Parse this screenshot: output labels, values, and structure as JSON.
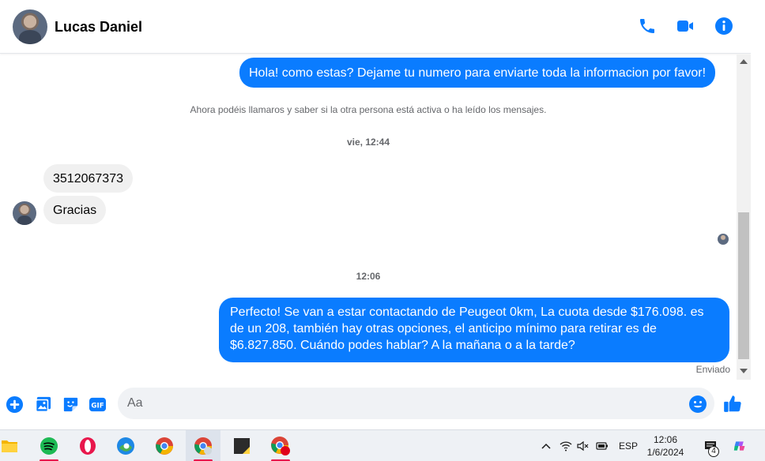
{
  "header": {
    "contact_name": "Lucas Daniel",
    "icons": [
      "phone-icon",
      "video-icon",
      "info-icon"
    ]
  },
  "messages": {
    "out_1": "Hola! como estas? Dejame tu numero para enviarte toda la informacion por favor!",
    "system_note": "Ahora podéis llamaros y saber si la otra persona está activa o ha leído los mensajes.",
    "time_1": "vie, 12:44",
    "in_1": "3512067373",
    "in_2": "Gracias",
    "time_2": "12:06",
    "out_2": "Perfecto!  Se van a estar contactando de Peugeot 0km, La cuota desde $176.098. es de un 208, también hay otras opciones, el anticipo mínimo para retirar es de $6.827.850. Cuándo podes hablar? A la mañana o a la tarde?",
    "status": "Enviado"
  },
  "composer": {
    "placeholder": "Aa",
    "value": "",
    "icons": [
      "add-circle-icon",
      "gallery-icon",
      "sticker-icon",
      "gif-icon",
      "emoji-icon",
      "thumbs-up-icon"
    ],
    "gif_label": "GIF"
  },
  "taskbar": {
    "apps": [
      "file-explorer-icon",
      "spotify-icon",
      "opera-icon",
      "edge-icon",
      "chrome-icon",
      "chrome-profile-icon",
      "sticky-notes-icon",
      "chrome-alt-icon"
    ],
    "language": "ESP",
    "time": "12:06",
    "date": "1/6/2024",
    "notifications": "4"
  },
  "colors": {
    "accent": "#0a7cff",
    "bubble_in": "#f0f0f0",
    "taskbar": "#eef1f5"
  }
}
